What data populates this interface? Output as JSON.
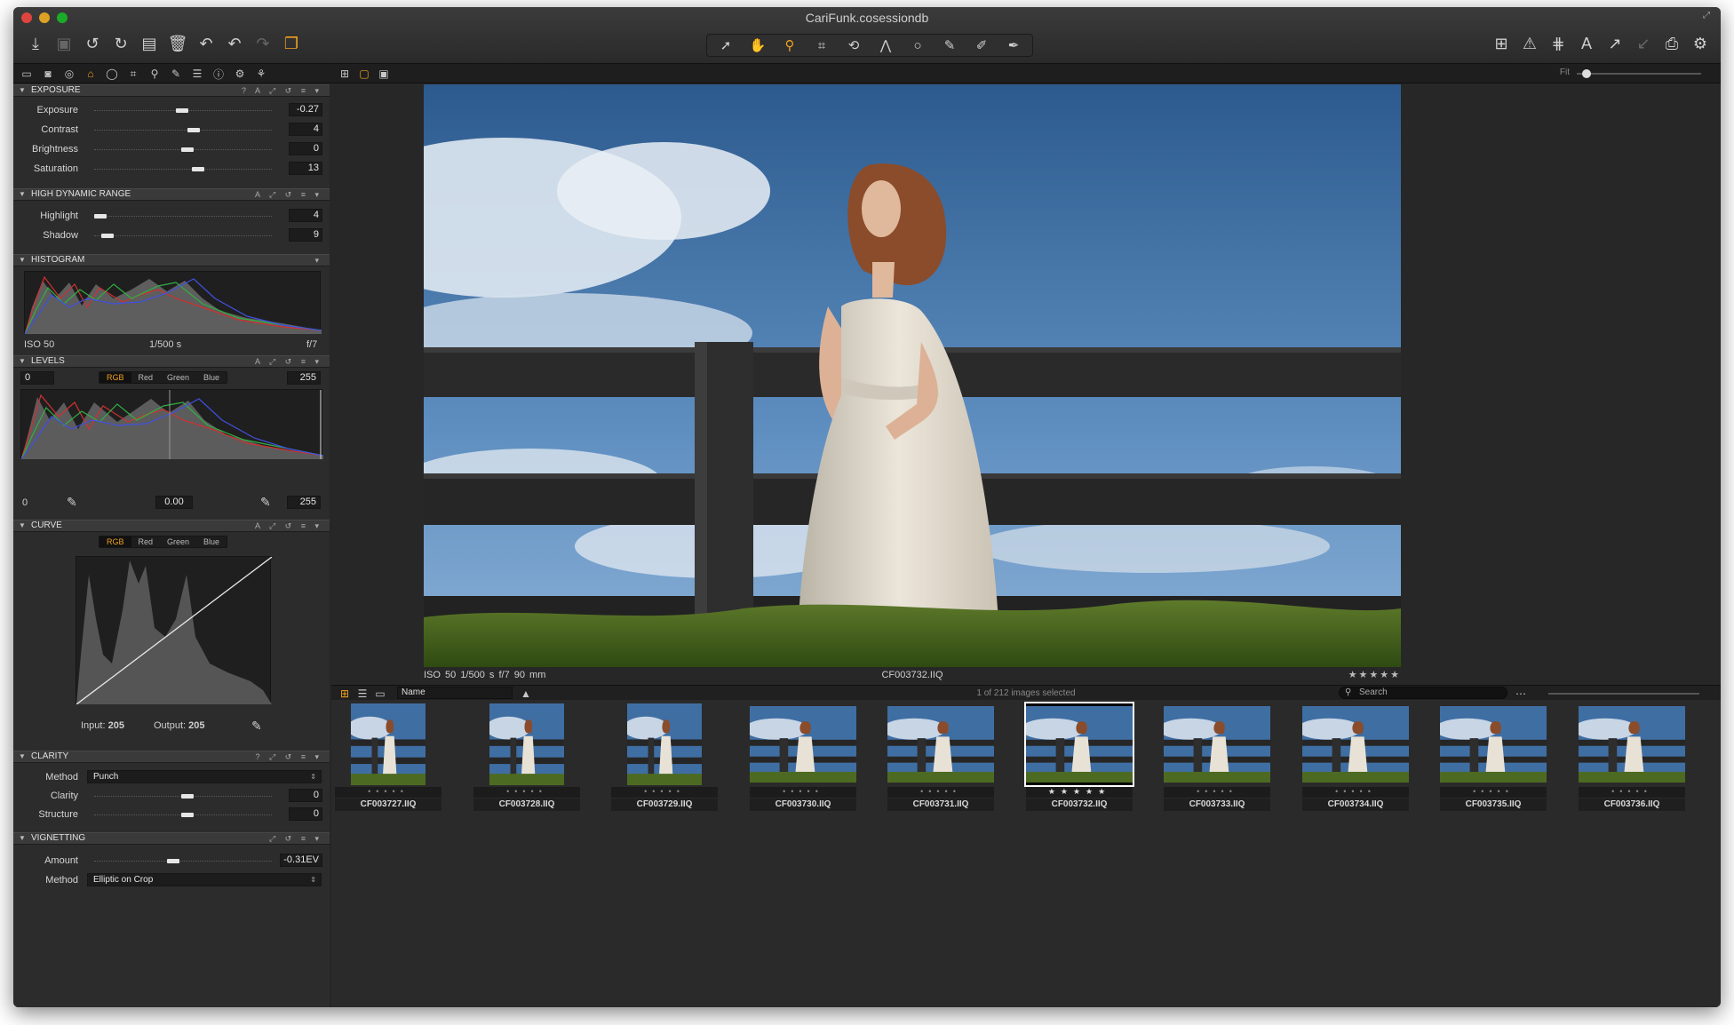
{
  "window": {
    "title": "CariFunk.cosessiondb"
  },
  "toolbar": {
    "left_icons": [
      "import-icon",
      "capture-icon",
      "rotate-left-icon",
      "rotate-right-icon",
      "move-to-icon",
      "trash-icon",
      "undo-icon",
      "undo-history-icon",
      "redo-icon",
      "variants-icon"
    ],
    "center_tools": [
      "select-cursor-icon",
      "pan-hand-icon",
      "loupe-icon",
      "crop-icon",
      "rotate-tool-icon",
      "keystone-icon",
      "spot-icon",
      "brush-icon",
      "pick-color-icon",
      "pick-wb-icon"
    ],
    "right_icons": [
      "grid-icon",
      "exposure-warning-icon",
      "guides-icon",
      "annotation-icon",
      "copy-adjustments-icon",
      "apply-adjustments-icon",
      "print-icon",
      "settings-icon"
    ]
  },
  "tooltabs": {
    "icons": [
      "folder-icon",
      "camera-icon",
      "color-icon",
      "exposure-tab-icon",
      "lens-icon",
      "crop-tab-icon",
      "details-icon",
      "local-adjust-icon",
      "metadata-icon",
      "output-icon",
      "adjustments-icon",
      "batch-icon"
    ],
    "fit_label": "Fit"
  },
  "exposure": {
    "title": "EXPOSURE",
    "rows": [
      {
        "label": "Exposure",
        "value": "-0.27"
      },
      {
        "label": "Contrast",
        "value": "4"
      },
      {
        "label": "Brightness",
        "value": "0"
      },
      {
        "label": "Saturation",
        "value": "13"
      }
    ]
  },
  "hdr": {
    "title": "HIGH DYNAMIC RANGE",
    "rows": [
      {
        "label": "Highlight",
        "value": "4"
      },
      {
        "label": "Shadow",
        "value": "9"
      }
    ]
  },
  "histogram": {
    "title": "HISTOGRAM",
    "iso": "ISO 50",
    "shutter": "1/500 s",
    "aperture": "f/7"
  },
  "levels": {
    "title": "LEVELS",
    "black": "0",
    "white": "255",
    "channels": [
      "RGB",
      "Red",
      "Green",
      "Blue"
    ],
    "out_black": "0",
    "mid": "0.00",
    "out_white": "255"
  },
  "curve": {
    "title": "CURVE",
    "channels": [
      "RGB",
      "Red",
      "Green",
      "Blue"
    ],
    "input_label": "Input:",
    "input_value": "205",
    "output_label": "Output:",
    "output_value": "205"
  },
  "clarity": {
    "title": "CLARITY",
    "method_label": "Method",
    "method_value": "Punch",
    "rows": [
      {
        "label": "Clarity",
        "value": "0"
      },
      {
        "label": "Structure",
        "value": "0"
      }
    ]
  },
  "vignetting": {
    "title": "VIGNETTING",
    "amount_label": "Amount",
    "amount_value": "-0.31EV",
    "method_label": "Method",
    "method_value": "Elliptic on Crop"
  },
  "viewer": {
    "iso": "ISO 50",
    "shutter": "1/500 s",
    "aperture": "f/7",
    "focal": "90 mm",
    "filename": "CF003732.IIQ",
    "stars": "★★★★★"
  },
  "browser": {
    "sort_label": "Name",
    "selection": "1 of 212 images selected",
    "search_placeholder": "Search",
    "thumbs": [
      {
        "name": "CF003727.IIQ",
        "orient": "portrait",
        "stars": "•••••"
      },
      {
        "name": "CF003728.IIQ",
        "orient": "portrait",
        "stars": "•••••"
      },
      {
        "name": "CF003729.IIQ",
        "orient": "portrait",
        "stars": "•••••"
      },
      {
        "name": "CF003730.IIQ",
        "orient": "landscape",
        "stars": "•••••"
      },
      {
        "name": "CF003731.IIQ",
        "orient": "landscape",
        "stars": "•••••"
      },
      {
        "name": "CF003732.IIQ",
        "orient": "landscape",
        "stars": "★★★★★",
        "selected": true
      },
      {
        "name": "CF003733.IIQ",
        "orient": "landscape",
        "stars": "•••••"
      },
      {
        "name": "CF003734.IIQ",
        "orient": "landscape",
        "stars": "•••••"
      },
      {
        "name": "CF003735.IIQ",
        "orient": "landscape",
        "stars": "•••••"
      },
      {
        "name": "CF003736.IIQ",
        "orient": "landscape",
        "stars": "•••••"
      }
    ]
  },
  "colors": {
    "accent": "#f0a020",
    "panel": "#2c2c2c",
    "background": "#262626"
  }
}
